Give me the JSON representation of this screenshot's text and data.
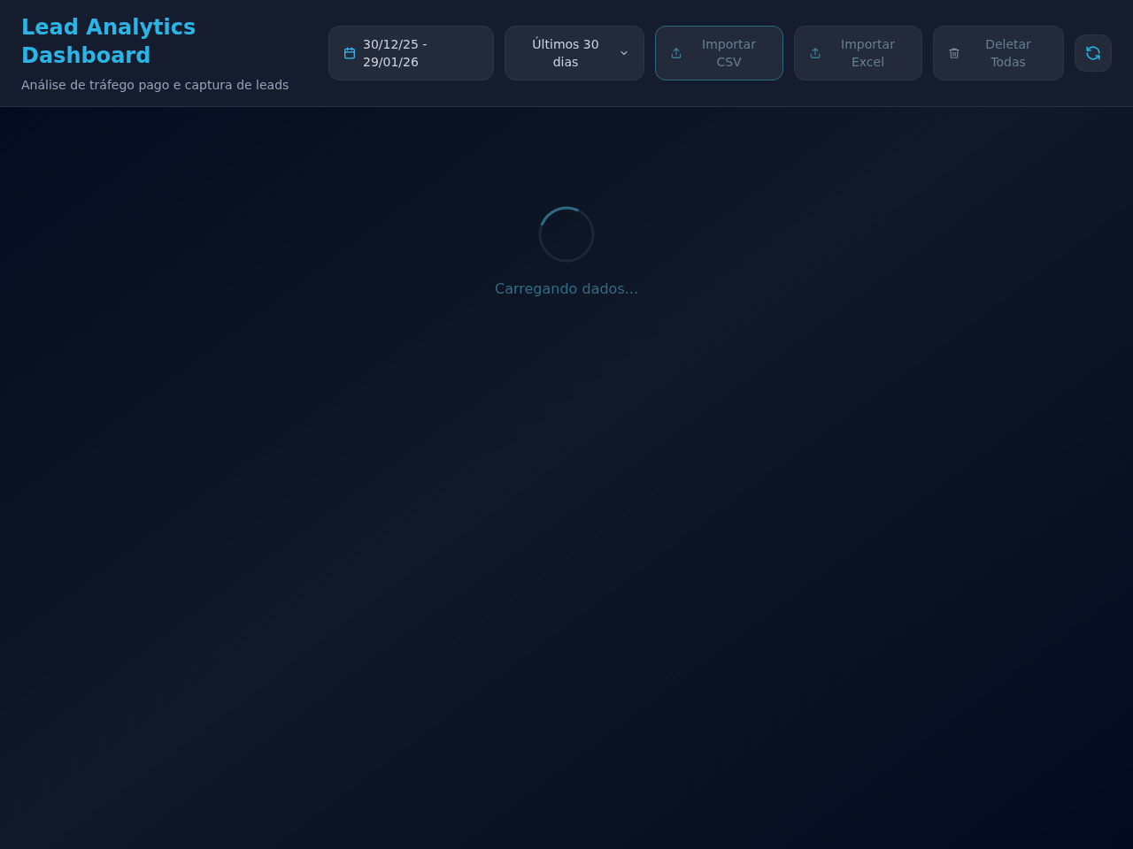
{
  "header": {
    "title": "Lead Analytics Dashboard",
    "subtitle": "Análise de tráfego pago e captura de leads"
  },
  "toolbar": [
    {
      "kind": "date",
      "label": "30/12/25 - 29/01/26",
      "disabled": false,
      "focused": false
    },
    {
      "kind": "select",
      "label": "Últimos 30 dias",
      "disabled": false,
      "focused": false
    },
    {
      "kind": "upload",
      "label": "Importar CSV",
      "disabled": true,
      "focused": true
    },
    {
      "kind": "upload",
      "label": "Importar Excel",
      "disabled": true,
      "focused": false
    },
    {
      "kind": "delete",
      "label": "Deletar Todas",
      "disabled": true,
      "focused": false
    },
    {
      "kind": "refresh",
      "disabled": false,
      "focused": false
    }
  ],
  "loading": {
    "message": "Carregando dados..."
  }
}
